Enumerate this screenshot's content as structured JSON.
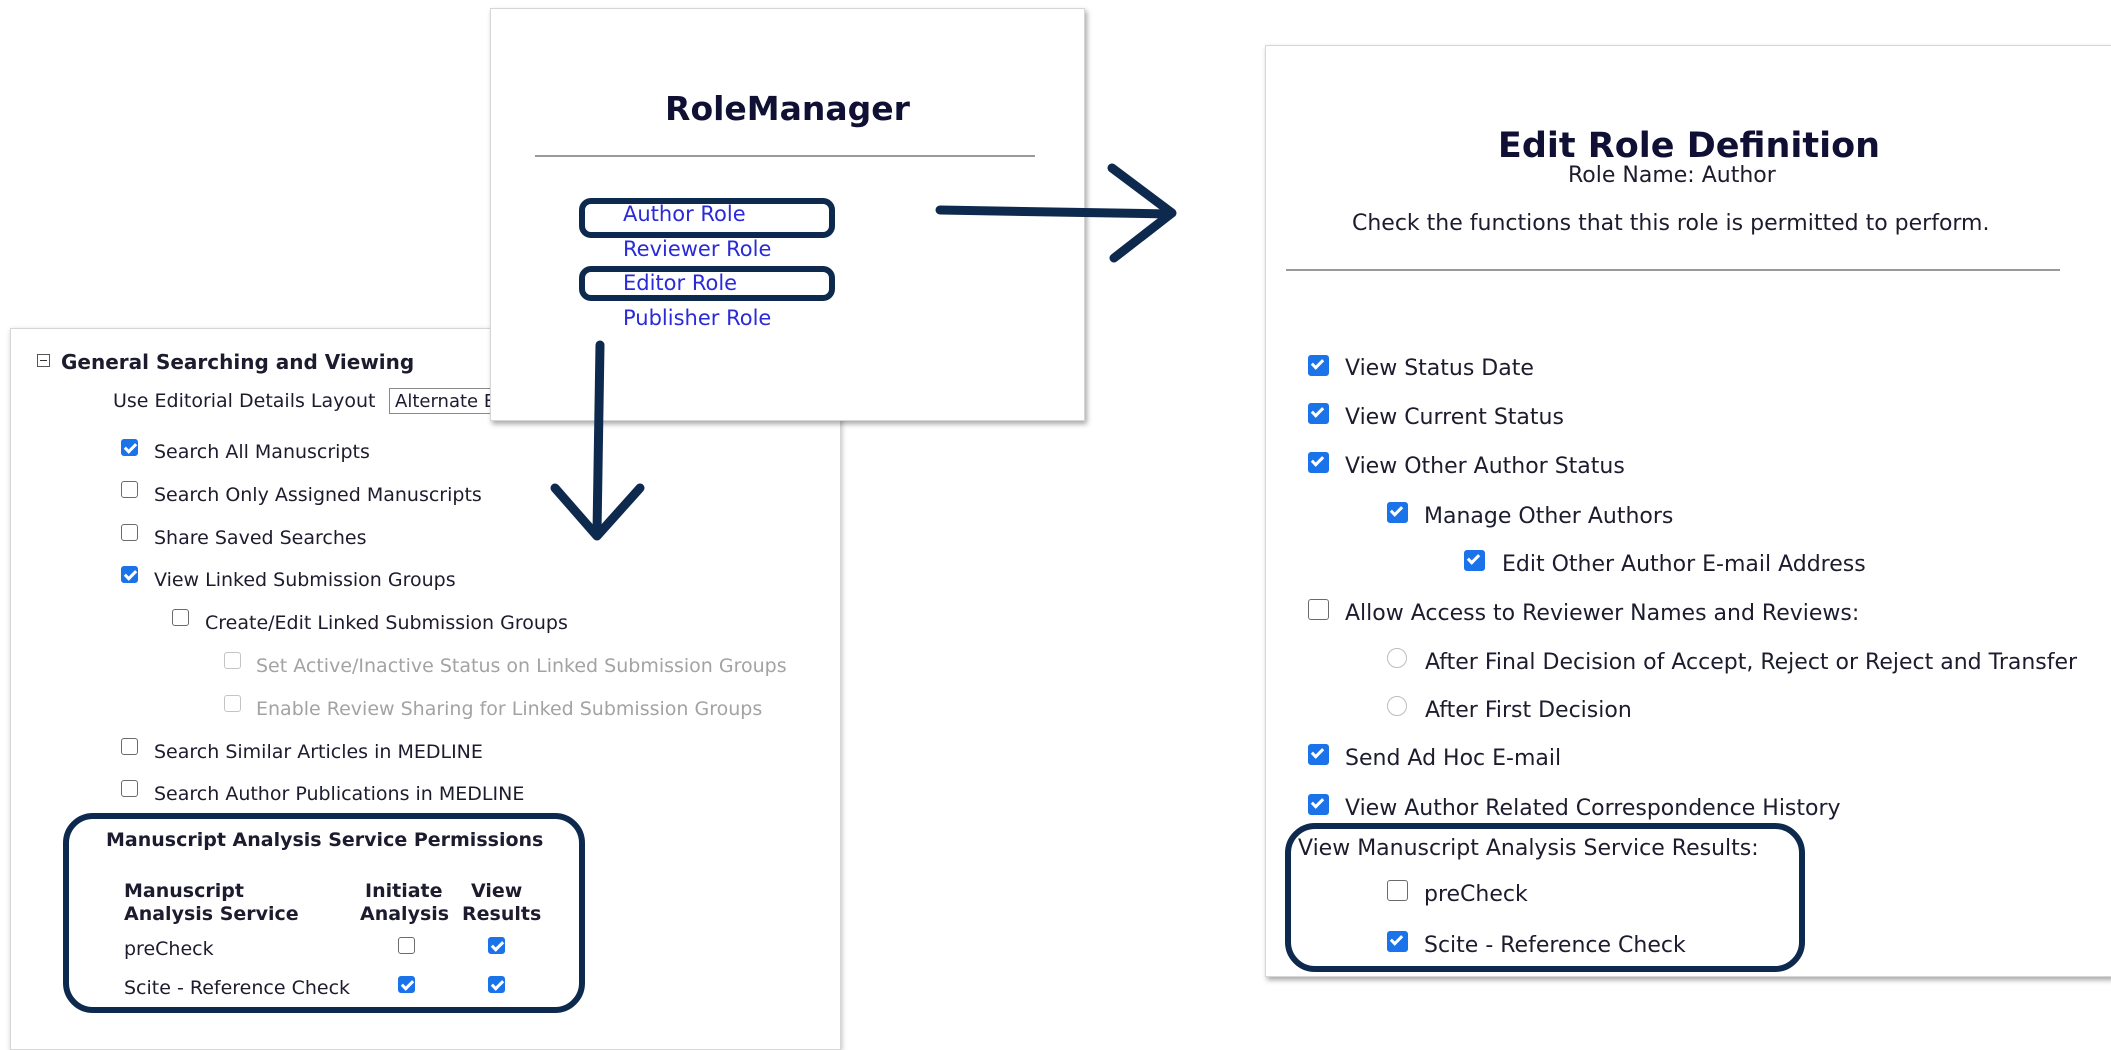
{
  "role_manager": {
    "title": "RoleManager",
    "links": [
      "Author Role",
      "Reviewer Role",
      "Editor Role",
      "Publisher Role"
    ]
  },
  "general_searching": {
    "section_title": "General Searching and Viewing",
    "layout_label": "Use Editorial Details Layout",
    "layout_value": "Alternate E",
    "items": [
      {
        "label": "Search All Manuscripts",
        "checked": true
      },
      {
        "label": "Search Only Assigned Manuscripts",
        "checked": false
      },
      {
        "label": "Share Saved Searches",
        "checked": false
      },
      {
        "label": "View Linked Submission Groups",
        "checked": true
      },
      {
        "label": "Create/Edit Linked Submission Groups",
        "checked": false
      },
      {
        "label": "Set Active/Inactive Status on Linked Submission Groups",
        "checked": false,
        "disabled": true
      },
      {
        "label": "Enable Review Sharing for Linked Submission Groups",
        "checked": false,
        "disabled": true
      },
      {
        "label": "Search Similar Articles in MEDLINE",
        "checked": false
      },
      {
        "label": "Search Author Publications in MEDLINE",
        "checked": false
      }
    ],
    "mas": {
      "title": "Manuscript Analysis Service Permissions",
      "col1_line1": "Manuscript",
      "col1_line2": "Analysis Service",
      "col2_line1": "Initiate",
      "col2_line2": "Analysis",
      "col3_line1": "View",
      "col3_line2": "Results",
      "rows": [
        {
          "service": "preCheck",
          "initiate": false,
          "view": true
        },
        {
          "service": "Scite - Reference Check",
          "initiate": true,
          "view": true
        }
      ]
    }
  },
  "edit_role": {
    "title": "Edit Role Definition",
    "role_name": "Role Name: Author",
    "instructions": "Check the functions that this role is permitted to perform.",
    "items": [
      {
        "label": "View Status Date",
        "checked": true
      },
      {
        "label": "View Current Status",
        "checked": true
      },
      {
        "label": "View Other Author Status",
        "checked": true
      },
      {
        "label": "Manage Other Authors",
        "checked": true
      },
      {
        "label": "Edit Other Author E-mail Address",
        "checked": true
      },
      {
        "label": "Allow Access to Reviewer Names and Reviews:",
        "checked": false
      },
      {
        "label": "After Final Decision of Accept, Reject or Reject and Transfer",
        "selected": false
      },
      {
        "label": "After First Decision",
        "selected": false
      },
      {
        "label": "Send Ad Hoc E-mail",
        "checked": true
      },
      {
        "label": "View Author Related Correspondence History",
        "checked": true
      }
    ],
    "mas_results_label": "View Manuscript Analysis Service Results:",
    "mas_results": [
      {
        "label": "preCheck",
        "checked": false
      },
      {
        "label": "Scite - Reference Check",
        "checked": true
      }
    ]
  },
  "colors": {
    "accent_navy": "#0d2a4e",
    "link_blue": "#2a2ad8",
    "checkbox_blue": "#1a73e8"
  }
}
